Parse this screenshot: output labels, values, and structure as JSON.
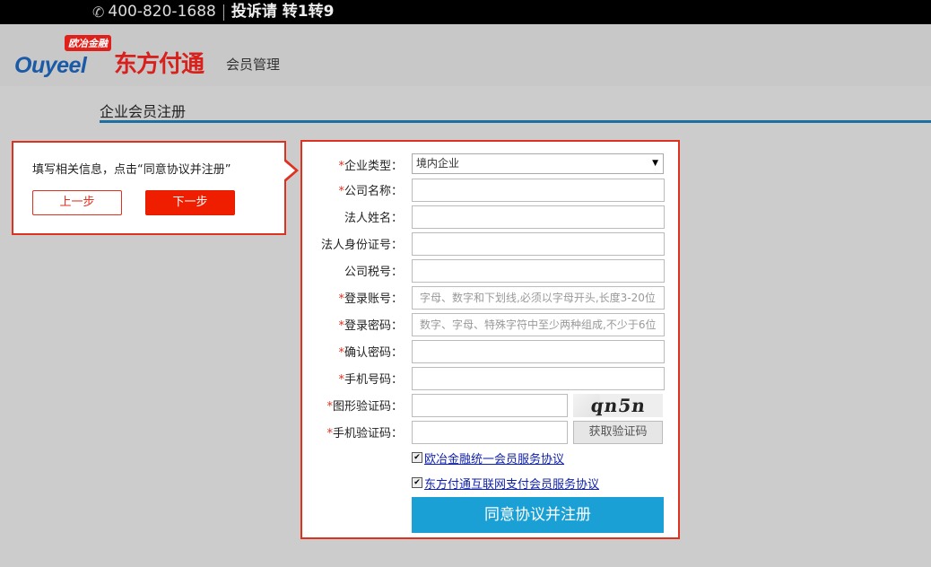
{
  "topbar": {
    "phone": "400-820-1688",
    "complaint": "投诉请 转1转9"
  },
  "header": {
    "logo_ouyeel": "Ouyeel",
    "logo_badge": "欧冶金融",
    "logo_brand": "东方付通",
    "logo_subtitle": "会员管理"
  },
  "page": {
    "title": "企业会员注册"
  },
  "tip": {
    "text": "填写相关信息，点击“同意协议并注册”",
    "prev_label": "上一步",
    "next_label": "下一步"
  },
  "form": {
    "fields": [
      {
        "label": "企业类型：",
        "required": "*",
        "value": "境内企业"
      },
      {
        "label": "公司名称：",
        "required": "*",
        "placeholder": ""
      },
      {
        "label": "法人姓名：",
        "required": "",
        "placeholder": ""
      },
      {
        "label": "法人身份证号：",
        "required": "",
        "placeholder": ""
      },
      {
        "label": "公司税号：",
        "required": "",
        "placeholder": ""
      },
      {
        "label": "登录账号：",
        "required": "*",
        "placeholder": "字母、数字和下划线,必须以字母开头,长度3-20位"
      },
      {
        "label": "登录密码：",
        "required": "*",
        "placeholder": "数字、字母、特殊字符中至少两种组成,不少于6位"
      },
      {
        "label": "确认密码：",
        "required": "*",
        "placeholder": ""
      },
      {
        "label": "手机号码：",
        "required": "*",
        "placeholder": ""
      },
      {
        "label": "图形验证码：",
        "required": "*",
        "placeholder": ""
      },
      {
        "label": "手机验证码：",
        "required": "*",
        "placeholder": ""
      }
    ],
    "captcha_text": "qn5n",
    "sms_button": "获取验证码",
    "agreement1": "欧冶金融统一会员服务协议",
    "agreement2": "东方付通互联网支付会员服务协议",
    "checkmark": "✔",
    "submit": "同意协议并注册"
  }
}
